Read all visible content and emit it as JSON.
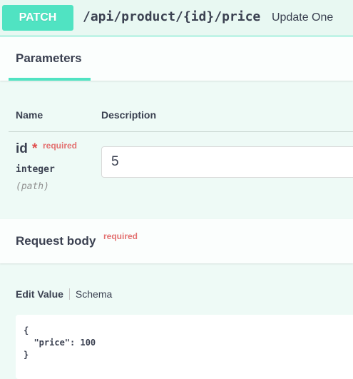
{
  "operation": {
    "method": "PATCH",
    "path": "/api/product/{id}/price",
    "summary": "Update One"
  },
  "tabs": {
    "parameters_label": "Parameters"
  },
  "parameters_table": {
    "columns": [
      "Name",
      "Description"
    ],
    "params": [
      {
        "name": "id",
        "required_star": "*",
        "required_label": "required",
        "type": "integer",
        "location": "(path)",
        "value": "5"
      }
    ]
  },
  "request_body": {
    "title": "Request body",
    "required_label": "required",
    "edit_value_tab": "Edit Value",
    "schema_tab": "Schema",
    "example_lines": [
      "{",
      "  \"price\": 100",
      "}"
    ]
  },
  "colors": {
    "accent": "#50e3c2",
    "required": "#e04c4c",
    "text": "#3b4151"
  }
}
